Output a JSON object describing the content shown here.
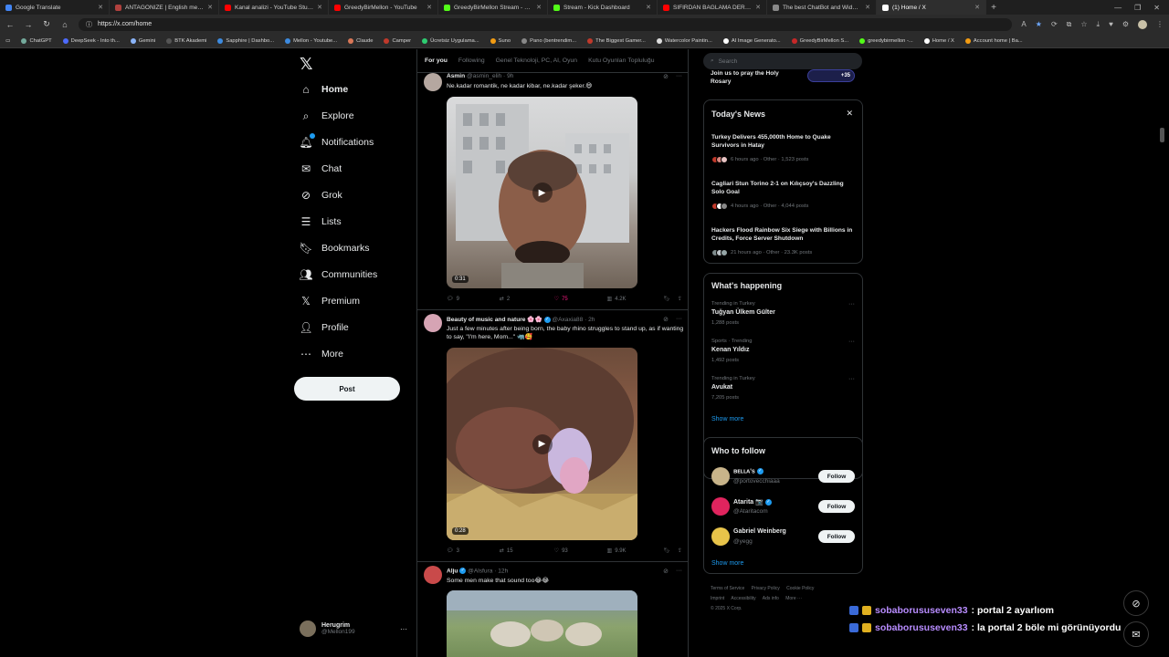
{
  "browser": {
    "tabs": [
      {
        "title": "Google Translate",
        "color": "#4285f4"
      },
      {
        "title": "ANTAGONIZE | English meaning",
        "color": "#b0413e"
      },
      {
        "title": "Kanal analizi - YouTube Studio",
        "color": "#ff0000"
      },
      {
        "title": "GreedyBirMellon - YouTube",
        "color": "#ff0000"
      },
      {
        "title": "GreedyBirMellon Stream - Watch",
        "color": "#53fc18"
      },
      {
        "title": "Stream - Kick Dashboard",
        "color": "#53fc18"
      },
      {
        "title": "SIFIRDAN BAĞLAMA DERSİ 3 (EN",
        "color": "#ff0000"
      },
      {
        "title": "The best ChatBot and Widgets fo",
        "color": "#888888"
      },
      {
        "title": "(1) Home / X",
        "color": "#ffffff"
      }
    ],
    "url": "https://x.com/home",
    "bookmarks": [
      "ChatGPT",
      "DeepSeek - Into th...",
      "Gemini",
      "BTK Akademi",
      "Sapphire | Dashbo...",
      "Mellon - Youtube...",
      "Claude",
      "Camper",
      "Ücretsiz Uygulama...",
      "Suno",
      "Pano (bentrendim...",
      "The Biggest Gamer...",
      "Watercolor Paintin...",
      "AI Image Generato...",
      "GreedyBirMellon S...",
      "greedybirmellon -...",
      "Home / X",
      "Account home | Ba..."
    ]
  },
  "nav": {
    "items": [
      {
        "label": "Home",
        "icon": "home-icon",
        "glyph": "⌂"
      },
      {
        "label": "Explore",
        "icon": "search-icon",
        "glyph": "⌕"
      },
      {
        "label": "Notifications",
        "icon": "bell-icon",
        "glyph": "🔔︎"
      },
      {
        "label": "Chat",
        "icon": "mail-icon",
        "glyph": "✉"
      },
      {
        "label": "Grok",
        "icon": "grok-icon",
        "glyph": "⊘"
      },
      {
        "label": "Lists",
        "icon": "list-icon",
        "glyph": "☰"
      },
      {
        "label": "Bookmarks",
        "icon": "bookmark-icon",
        "glyph": "🔖︎"
      },
      {
        "label": "Communities",
        "icon": "people-icon",
        "glyph": "👥︎"
      },
      {
        "label": "Premium",
        "icon": "x-premium-icon",
        "glyph": "𝕏"
      },
      {
        "label": "Profile",
        "icon": "person-icon",
        "glyph": "👤︎"
      },
      {
        "label": "More",
        "icon": "more-circle-icon",
        "glyph": "⋯"
      }
    ],
    "post_label": "Post",
    "account": {
      "name": "Herugrim",
      "handle": "@Mellon199"
    }
  },
  "feed": {
    "tabs": [
      "For you",
      "Following",
      "Genel Teknoloji, PC, AI, Oyun",
      "Kutu Oyunları Topluluğu"
    ],
    "tweets": [
      {
        "author": "Asmin",
        "handle": "@asmin_elih",
        "time": "9h",
        "text": "Ne.kadar romantik, ne kadar kibar, ne.kadar şeker.😄",
        "duration": "0:31",
        "replies": "9",
        "retweets": "2",
        "likes": "75",
        "views": "4.2K"
      },
      {
        "author": "Beauty of music and nature 🌸🌸",
        "handle": "@Axaxia88",
        "time": "2h",
        "text": "Just a few minutes after being born, the baby rhino struggles to stand up, as if wanting to say, \"I'm here, Mom...\" 🦏🥰",
        "duration": "0:28",
        "replies": "3",
        "retweets": "15",
        "likes": "93",
        "views": "9.9K"
      },
      {
        "author": "Alju",
        "handle": "@Alsfura",
        "time": "12h",
        "text": "Some men make that sound too😂😂"
      }
    ]
  },
  "right": {
    "search_placeholder": "Search",
    "pray": {
      "text": "Join us to pray the Holy Rosary",
      "count": "+35"
    },
    "news": {
      "title": "Today's News",
      "items": [
        {
          "headline": "Turkey Delivers 455,000th Home to Quake Survivors in Hatay",
          "meta": "6 hours ago · Other · 1,523 posts"
        },
        {
          "headline": "Cagliari Stun Torino 2-1 on Kılıçsoy's Dazzling Solo Goal",
          "meta": "4 hours ago · Other · 4,044 posts"
        },
        {
          "headline": "Hackers Flood Rainbow Six Siege with Billions in Credits, Force Server Shutdown",
          "meta": "21 hours ago · Other · 23.3K posts"
        }
      ]
    },
    "happening": {
      "title": "What's happening",
      "trends": [
        {
          "context": "Trending in Turkey",
          "name": "Tuğyan Ülkem Gülter",
          "count": "1,288 posts"
        },
        {
          "context": "Sports · Trending",
          "name": "Kenan Yıldız",
          "count": "1,492 posts"
        },
        {
          "context": "Trending in Turkey",
          "name": "Avukat",
          "count": "7,205 posts"
        }
      ],
      "show_more": "Show more"
    },
    "who_to_follow": {
      "title": "Who to follow",
      "users": [
        {
          "name": "ʙᴇʟʟᴀ's",
          "handle": "@portovecchiaaa",
          "color": "#c8b48a"
        },
        {
          "name": "Atarita 📷",
          "handle": "@Ataritacom",
          "color": "#e0245e"
        },
        {
          "name": "Gabriel Weinberg",
          "handle": "@yegg",
          "color": "#e8c44a"
        }
      ],
      "follow_label": "Follow",
      "show_more": "Show more"
    },
    "footer": [
      "Terms of Service",
      "Privacy Policy",
      "Cookie Policy",
      "Imprint",
      "Accessibility",
      "Ads info",
      "More ···",
      "© 2025 X Corp."
    ]
  },
  "stream_chat": [
    {
      "user": "sobaborususeven33",
      "message": ": portal 2 ayarlıom"
    },
    {
      "user": "sobaborususeven33",
      "message": ": la portal 2 böle mi görünüyordu"
    }
  ]
}
